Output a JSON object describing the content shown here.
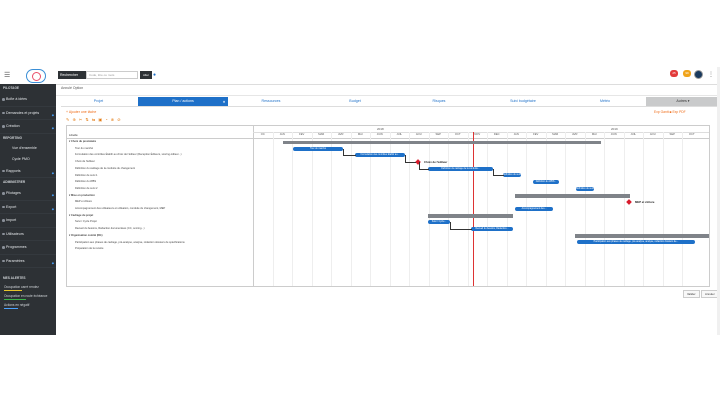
{
  "topbar": {
    "search_button": "Rechercher",
    "search_placeholder": "Code, titre ou mots",
    "search_go": "Aller",
    "badge_red": "25",
    "badge_orange": "99"
  },
  "sidebar": {
    "section_pilotage": "PILOTAGE",
    "items": [
      {
        "label": "Boîte à idées"
      },
      {
        "label": "Demandes et projets"
      },
      {
        "label": "Création"
      }
    ],
    "section_reporting": "REPORTING",
    "reporting_items": [
      {
        "label": "Vue d'ensemble"
      },
      {
        "label": "Cycle PMO"
      },
      {
        "label": "Rapports"
      }
    ],
    "section_admin": "ADMINISTRER",
    "admin_items": [
      {
        "label": "Pilotages"
      },
      {
        "label": "Export"
      },
      {
        "label": "Import"
      },
      {
        "label": "Utilisateurs"
      },
      {
        "label": "Programmes"
      },
      {
        "label": "Paramètres"
      }
    ],
    "section_alerts": "MES ALERTES",
    "alerts": [
      {
        "label": "Occupation carré rendez",
        "color": "#e7c52b"
      },
      {
        "label": "Occupation en route échéance",
        "color": "#3bb54a"
      },
      {
        "label": "Actions en négatif",
        "color": "#4aa3ff"
      }
    ]
  },
  "breadcrumb": "Annulé Option",
  "tabs": [
    {
      "label": "Projet"
    },
    {
      "label": "Plan / actions"
    },
    {
      "label": "Ressources"
    },
    {
      "label": "Budget"
    },
    {
      "label": "Risques"
    },
    {
      "label": "Suivi budgétaire"
    },
    {
      "label": "Météo"
    },
    {
      "label": "Autres ▾"
    }
  ],
  "add_link": "+ Ajouter une tâche",
  "export_links": "Exp Gantt ■ Exp PDF",
  "toolbar_icons": "✎ ⊕ ✂ ⇅ ⇆ ▣ ◔ ⊗ ⊘",
  "gantt": {
    "task_header": "Libellé",
    "years": [
      "2018",
      "2019"
    ],
    "months": [
      "OC",
      "JAN",
      "FEV",
      "MAR",
      "AVR",
      "MAI",
      "JUIN",
      "JUIL",
      "AOU",
      "SEP",
      "OCT",
      "NOV",
      "DEC",
      "JAN",
      "FEV",
      "MAR",
      "AVR",
      "MAI",
      "JUIN",
      "JUIL",
      "AOU",
      "SEP",
      "OCT"
    ],
    "tasks": [
      "▾ Choix du prestataire",
      "Tour du marché",
      "Formulation des contrôles Établir au choix de l'éditeur (Reception Éditeurs, scoring éditeur...)",
      "Choix de l'éditeur",
      "Définition du cadrage de la conduite du changement",
      "Définition de suivi 1",
      "Définition du WBS",
      "Définition de suivi 2",
      "▾ Mise en production",
      "MEP et clôture",
      "Accompagnement des utilisateurs et utilisation, conduite du changement, MEP",
      "▾ Cadrage du projet",
      "Suivi / Cycle Projet",
      "Recueil du besoins, Rédaction documentées (CC, scoring...)",
      "▾ Organisation comité (DG)",
      "Participation aux phases de cadrage, pré-analyse, analyse, rédaction dossiers de spécifications",
      "Préparation de la recette"
    ],
    "bars": [
      "Tour du marché",
      "Formulation des contrôles Établir au...",
      "Définition du cadrage de la conduite...",
      "Définition du suivi...",
      "Définition du WBS...",
      "Définition du suivi...",
      "Accompagnement des...",
      "Suivi / Cycle...",
      "Recueil du besoins, Rédaction...",
      "Participation aux phases de cadrage, pré-analyse, analyse, rédaction dossiers de..."
    ],
    "milestones": [
      "Choix de l'éditeur",
      "MEP et clôture"
    ]
  },
  "buttons": {
    "validate": "Valider",
    "cancel": "Annuler"
  }
}
